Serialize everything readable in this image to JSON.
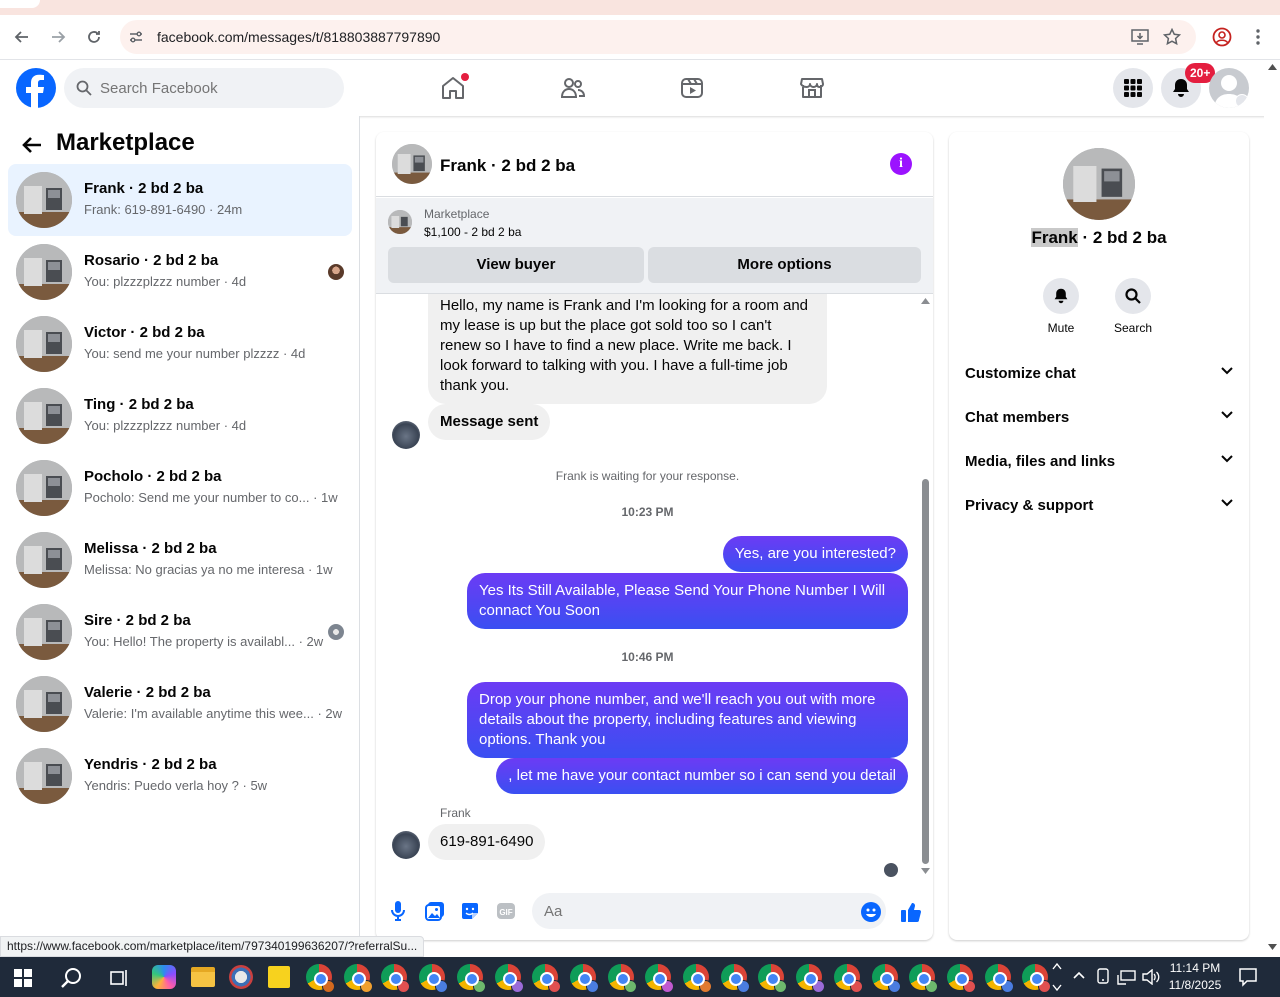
{
  "browser": {
    "url": "facebook.com/messages/t/818803887797890",
    "status_url": "https://www.facebook.com/marketplace/item/797340199636207/?referralSu..."
  },
  "fb_header": {
    "search_placeholder": "Search Facebook",
    "notification_badge": "20+"
  },
  "left_panel": {
    "title": "Marketplace",
    "conversations": [
      {
        "name": "Frank · 2 bd 2 ba",
        "preview": "Frank: 619-891-6490 · 24m",
        "active": true
      },
      {
        "name": "Rosario · 2 bd 2 ba",
        "preview": "You: plzzzplzzz number · 4d"
      },
      {
        "name": "Victor · 2 bd 2 ba",
        "preview": "You: send me your number plzzzz · 4d"
      },
      {
        "name": "Ting · 2 bd 2 ba",
        "preview": "You: plzzzplzzz number · 4d"
      },
      {
        "name": "Pocholo · 2 bd 2 ba",
        "preview": "Pocholo: Send me your number to co... · 1w"
      },
      {
        "name": "Melissa · 2 bd 2 ba",
        "preview": "Melissa: No gracias ya no me interesa · 1w"
      },
      {
        "name": "Sire · 2 bd 2 ba",
        "preview": "You: Hello! The property is availabl... · 2w"
      },
      {
        "name": "Valerie · 2 bd 2 ba",
        "preview": "Valerie: I'm available anytime this wee... · 2w"
      },
      {
        "name": "Yendris · 2 bd 2 ba",
        "preview": "Yendris: Puedo verla hoy ? · 5w"
      }
    ]
  },
  "chat": {
    "title": "Frank · 2 bd 2 ba",
    "marketplace_label": "Marketplace",
    "listing": "$1,100 - 2 bd 2 ba",
    "view_buyer": "View buyer",
    "more_options": "More options",
    "messages": {
      "m1": "Hello, my name is Frank and I'm looking for a room and my lease is up but the place got sold too so I can't renew so I have to find a new place. Write me back. I look forward to talking with you. I have a full-time job thank you.",
      "m2": "Message sent",
      "waiting": "Frank is waiting for your response.",
      "ts1": "10:23 PM",
      "m3": "Yes, are you interested?",
      "m4": "Yes Its Still Available, Please Send Your Phone Number I Will connact You Soon",
      "ts2": "10:46 PM",
      "m5": "Drop your phone number, and we'll reach you out with more details about the property, including features and viewing options.  Thank you",
      "m6": ", let me have your contact number so i can send you detail",
      "sender": "Frank",
      "m7": "619-891-6490"
    },
    "composer_placeholder": "Aa"
  },
  "right_panel": {
    "title_highlight": "Frank",
    "title_rest": " · 2 bd 2 ba",
    "mute": "Mute",
    "search": "Search",
    "sections": [
      "Customize chat",
      "Chat members",
      "Media, files and links",
      "Privacy & support"
    ]
  },
  "taskbar": {
    "time": "11:14 PM",
    "date": "11/8/2025"
  },
  "colors": {
    "fb_blue": "#0866ff",
    "outgoing_bubble": "#5b44f3",
    "active_conv": "#e9f3ff",
    "info_purple": "#9b13ff"
  }
}
